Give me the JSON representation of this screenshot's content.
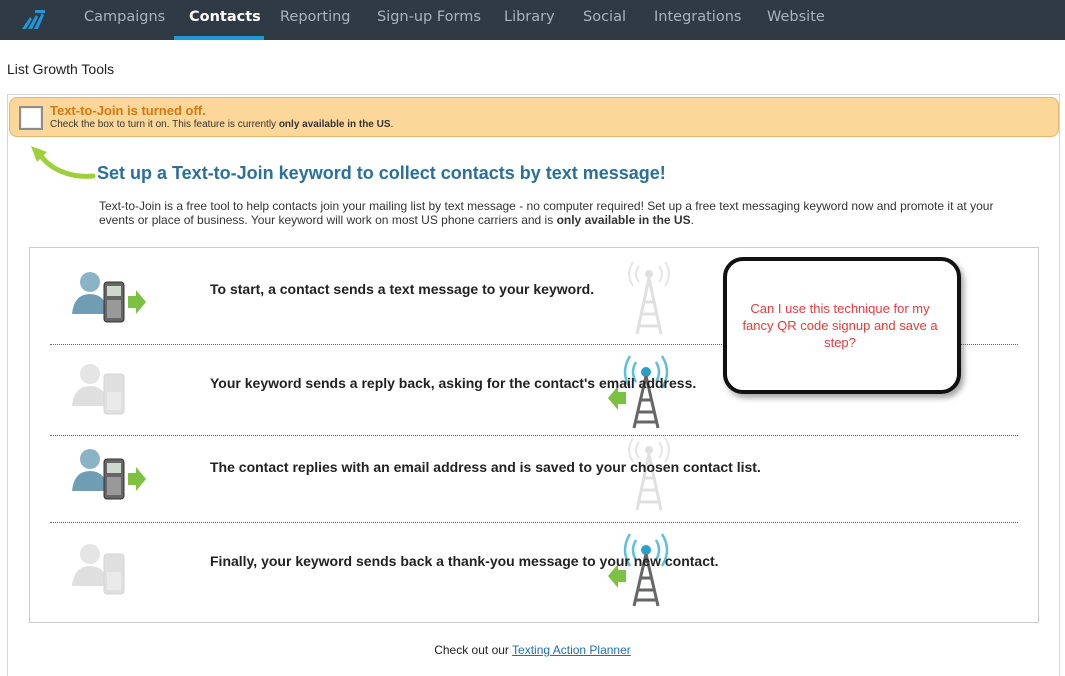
{
  "nav": {
    "items": [
      {
        "label": "Campaigns"
      },
      {
        "label": "Contacts"
      },
      {
        "label": "Reporting"
      },
      {
        "label": "Sign-up Forms"
      },
      {
        "label": "Library"
      },
      {
        "label": "Social"
      },
      {
        "label": "Integrations"
      },
      {
        "label": "Website"
      }
    ],
    "active": "Contacts"
  },
  "page": {
    "title": "List Growth Tools"
  },
  "banner": {
    "title": "Text-to-Join is turned off.",
    "text_prefix": "Check the box to turn it on. This feature is currently ",
    "text_bold": "only available in the US",
    "text_suffix": ".",
    "checked": false
  },
  "intro": {
    "headline": "Set up a Text-to-Join keyword to collect contacts by text message!",
    "desc_prefix": "Text-to-Join is a free tool to help contacts join your mailing list by text message - no computer required! Set up a free text messaging keyword now and promote it at your events or place of business. Your keyword will work on most US phone carriers and is ",
    "desc_bold": "only available in the US",
    "desc_suffix": "."
  },
  "steps": [
    {
      "text": "To start, a contact sends a text message to your keyword.",
      "direction": "to-tower"
    },
    {
      "text": "Your keyword sends a reply back, asking for the contact's email address.",
      "direction": "from-tower"
    },
    {
      "text": "The contact replies with an email address and is saved to your chosen contact list.",
      "direction": "to-tower"
    },
    {
      "text": "Finally, your keyword sends back a thank-you message to your new contact.",
      "direction": "from-tower"
    }
  ],
  "callout": {
    "text": "Can I use this technique for my fancy QR code signup and save a step?"
  },
  "footer": {
    "prefix": "Check out our ",
    "link": "Texting Action Planner"
  },
  "colors": {
    "nav_bg": "#2f3a45",
    "nav_active_underline": "#1e98d9",
    "banner_bg": "#fbd89a",
    "banner_title": "#d9760d",
    "headline": "#2b6f9c",
    "callout_text": "#e53b3b",
    "arrow_green": "#7dc142"
  },
  "icons": [
    "logo-icon",
    "curved-arrow-icon",
    "person-phone-icon",
    "signal-tower-icon",
    "green-arrow-icon"
  ]
}
